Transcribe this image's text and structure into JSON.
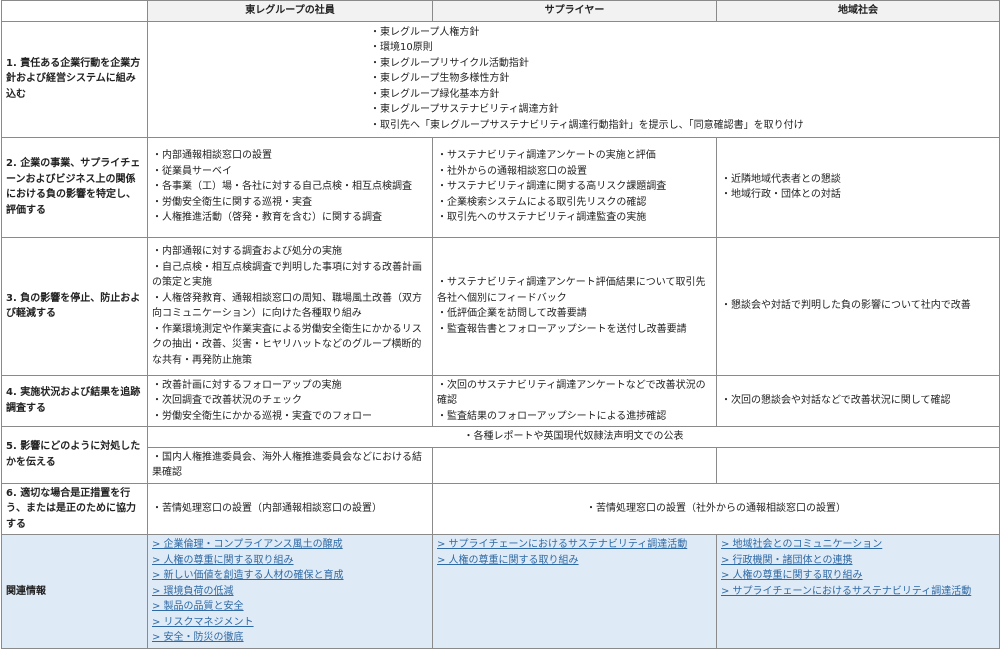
{
  "header": {
    "col_employees": "東レグループの社員",
    "col_suppliers": "サプライヤー",
    "col_community": "地域社会"
  },
  "rows": {
    "r1": {
      "label": "1. 責任ある企業行動を企業方針および経営システムに組み込む",
      "items": [
        "東レグループ人権方針",
        "環境10原則",
        "東レグループリサイクル活動指針",
        "東レグループ生物多様性方針",
        "東レグループ緑化基本方針",
        "東レグループサステナビリティ調達方針",
        "取引先へ「東レグループサステナビリティ調達行動指針」を提示し、「同意確認書」を取り付け"
      ]
    },
    "r2": {
      "label": "2. 企業の事業、サプライチェーンおよびビジネス上の関係における負の影響を特定し、評価する",
      "employees": [
        "内部通報相談窓口の設置",
        "従業員サーベイ",
        "各事業（工）場・各社に対する自己点検・相互点検調査",
        "労働安全衛生に関する巡視・実査",
        "人権推進活動（啓発・教育を含む）に関する調査"
      ],
      "suppliers": [
        "サステナビリティ調達アンケートの実施と評価",
        "社外からの通報相談窓口の設置",
        "サステナビリティ調達に関する高リスク課題調査",
        "企業検索システムによる取引先リスクの確認",
        "取引先へのサステナビリティ調達監査の実施"
      ],
      "community": [
        "近隣地域代表者との懇談",
        "地域行政・団体との対話"
      ]
    },
    "r3": {
      "label": "3. 負の影響を停止、防止および軽減する",
      "employees": [
        "内部通報に対する調査および処分の実施",
        "自己点検・相互点検調査で判明した事項に対する改善計画の策定と実施",
        "人権啓発教育、通報相談窓口の周知、職場風土改善（双方向コミュニケーション）に向けた各種取り組み",
        "作業環境測定や作業実査による労働安全衛生にかかるリスクの抽出・改善、災害・ヒヤリハットなどのグループ横断的な共有・再発防止施策"
      ],
      "suppliers": [
        "サステナビリティ調達アンケート評価結果について取引先各社へ個別にフィードバック",
        "低評価企業を訪問して改善要請",
        "監査報告書とフォローアップシートを送付し改善要請"
      ],
      "community": [
        "懇談会や対話で判明した負の影響について社内で改善"
      ]
    },
    "r4": {
      "label": "4. 実施状況および結果を追跡調査する",
      "employees": [
        "改善計画に対するフォローアップの実施",
        "次回調査で改善状況のチェック",
        "労働安全衛生にかかる巡視・実査でのフォロー"
      ],
      "suppliers": [
        "次回のサステナビリティ調達アンケートなどで改善状況の確認",
        "監査結果のフォローアップシートによる進捗確認"
      ],
      "community": [
        "次回の懇談会や対話などで改善状況に関して確認"
      ]
    },
    "r5": {
      "label": "5. 影響にどのように対処したかを伝える",
      "all": "各種レポートや英国現代奴隷法声明文での公表",
      "employees": "国内人権推進委員会、海外人権推進委員会などにおける結果確認"
    },
    "r6": {
      "label": "6. 適切な場合是正措置を行う、または是正のために協力する",
      "employees": "苦情処理窓口の設置（内部通報相談窓口の設置）",
      "others": "苦情処理窓口の設置（社外からの通報相談窓口の設置）"
    },
    "related": {
      "label": "関連情報",
      "employees": [
        "> 企業倫理・コンプライアンス風土の醸成",
        "> 人権の尊重に関する取り組み",
        "> 新しい価値を創造する人材の確保と育成",
        "> 環境負荷の低減",
        "> 製品の品質と安全",
        "> リスクマネジメント",
        "> 安全・防災の徹底"
      ],
      "suppliers": [
        "> サプライチェーンにおけるサステナビリティ調達活動",
        "> 人権の尊重に関する取り組み"
      ],
      "community": [
        "> 地域社会とのコミュニケーション",
        "> 行政機関・諸団体との連携",
        "> 人権の尊重に関する取り組み",
        "> サプライチェーンにおけるサステナビリティ調達活動"
      ]
    }
  },
  "colors": {
    "header_bg": "#f2f2f2",
    "related_bg": "#deeaf6",
    "link": "#2f6aa5",
    "border": "#8a8a8a"
  }
}
